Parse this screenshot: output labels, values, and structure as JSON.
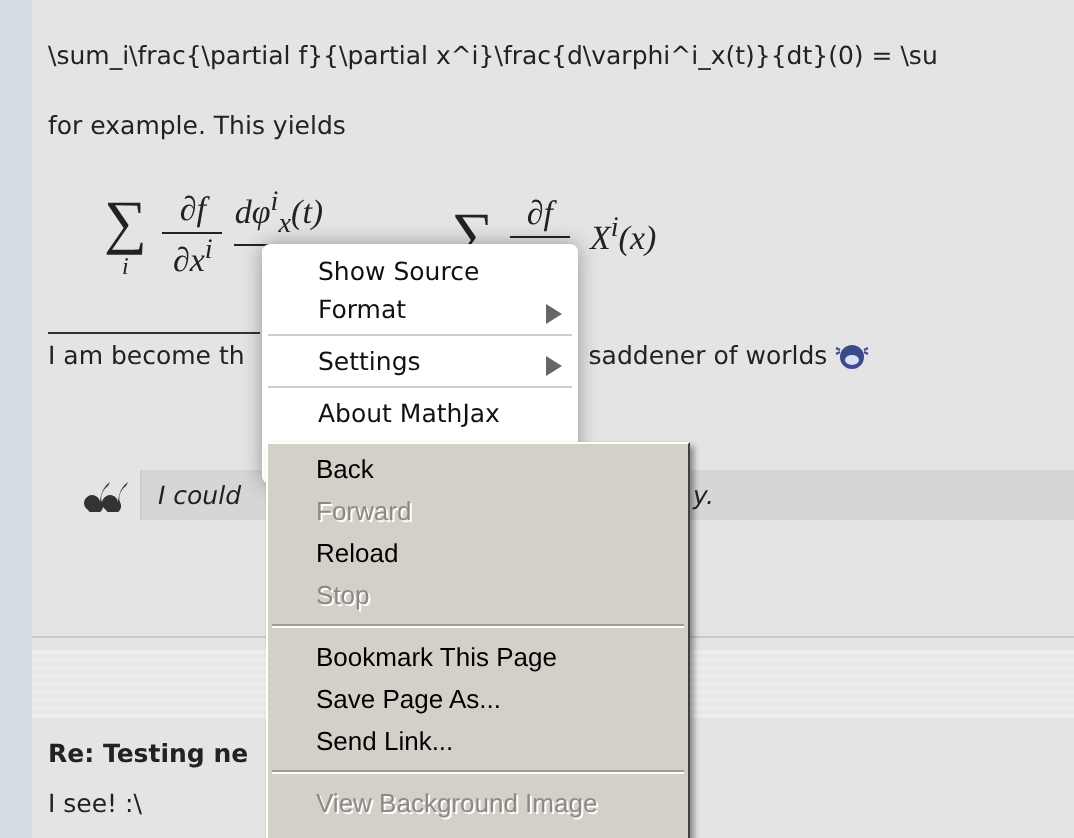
{
  "post": {
    "source_line": "\\sum_i\\frac{\\partial f}{\\partial x^i}\\frac{d\\varphi^i_x(t)}{dt}(0) = \\su",
    "intro": "for example. This yields",
    "math": [
      {
        "kind": "sum",
        "symbol": "∑",
        "sub": "i"
      },
      {
        "kind": "frac",
        "num": "∂f",
        "den": "∂x$^{i}$"
      },
      {
        "kind": "frac",
        "num": "dφ$^{i}$$_{x}$(t)"
      },
      {
        "kind": "sum",
        "symbol": "∑"
      },
      {
        "kind": "frac",
        "num": "∂f"
      },
      {
        "kind": "term",
        "text": "X$^{i}$(x)"
      }
    ],
    "signature_start": "I am become th",
    "signature_end": "saddener of worlds",
    "quote_start": "I could",
    "quote_end": "y."
  },
  "reply": {
    "title": "Re: Testing ne",
    "body": "I see! :\\"
  },
  "mathjax_menu": [
    {
      "label": "Show Source",
      "submenu": false
    },
    {
      "label": "Format",
      "submenu": true
    },
    {
      "kind": "separator"
    },
    {
      "label": "Settings",
      "submenu": true
    },
    {
      "kind": "separator"
    },
    {
      "label": "About MathJax",
      "submenu": false
    }
  ],
  "context_menu": [
    {
      "label": "Back",
      "disabled": false
    },
    {
      "label": "Forward",
      "disabled": true
    },
    {
      "label": "Reload",
      "disabled": false
    },
    {
      "label": "Stop",
      "disabled": true
    },
    {
      "kind": "separator"
    },
    {
      "label": "Bookmark This Page",
      "disabled": false
    },
    {
      "label": "Save Page As...",
      "disabled": false
    },
    {
      "label": "Send Link...",
      "disabled": false
    },
    {
      "kind": "separator"
    },
    {
      "label": "View Background Image",
      "disabled": true
    }
  ]
}
